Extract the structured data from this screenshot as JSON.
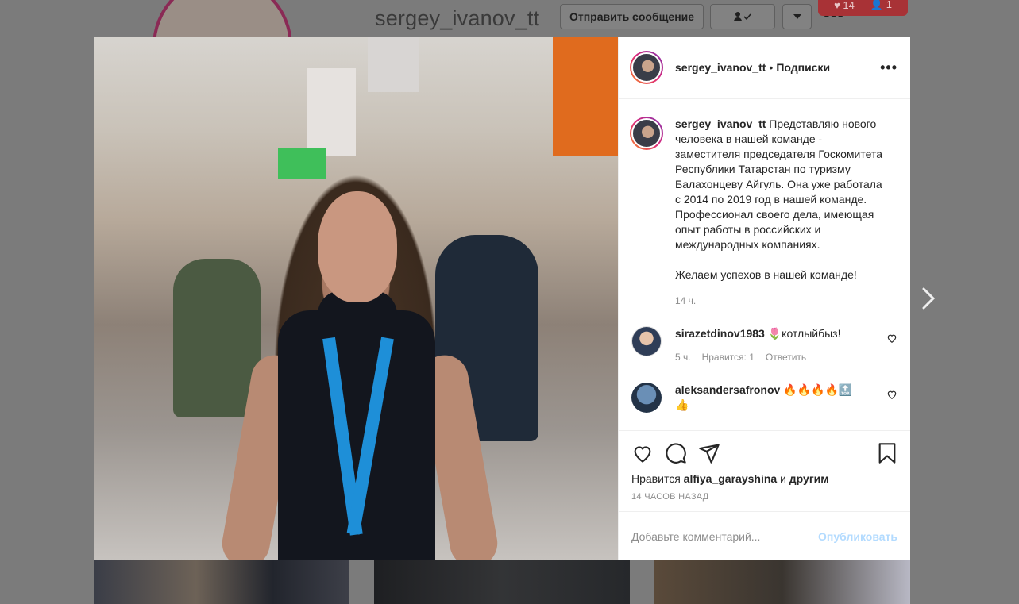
{
  "background": {
    "username": "sergey_ivanov_tt",
    "message_button": "Отправить сообщение",
    "follow_icon": "person-check-icon",
    "notif_likes": "14",
    "notif_follows": "1"
  },
  "post": {
    "author": "sergey_ivanov_tt",
    "dot": "•",
    "follow_label": "Подписки",
    "caption": "Представляю нового человека в нашей команде - заместителя председателя Госкомитета Республики Татарстан по туризму Балахонцеву Айгуль. Она уже работала с 2014 по 2019 год в нашей команде. Профессионал своего дела, имеющая опыт работы в российских и международных компаниях.",
    "caption_wish": "Желаем успехов в нашей команде!",
    "caption_time": "14 ч.",
    "comments": [
      {
        "user": "sirazetdinov1983",
        "text": "🌷котлыйбыз!",
        "time": "5 ч.",
        "likes": "Нравится: 1",
        "reply": "Ответить"
      },
      {
        "user": "aleksandersafronov",
        "text": "🔥🔥🔥🔥🔝👍"
      }
    ],
    "likes_prefix": "Нравится",
    "likes_user": "alfiya_garayshina",
    "likes_and": "и",
    "likes_others": "другим",
    "time_ago": "14 часов назад",
    "comment_placeholder": "Добавьте комментарий...",
    "publish_label": "Опубликовать"
  },
  "colors": {
    "link_disabled": "#b3dbff",
    "muted_text": "#8e8e8e",
    "overlay": "#7b7b7b"
  }
}
